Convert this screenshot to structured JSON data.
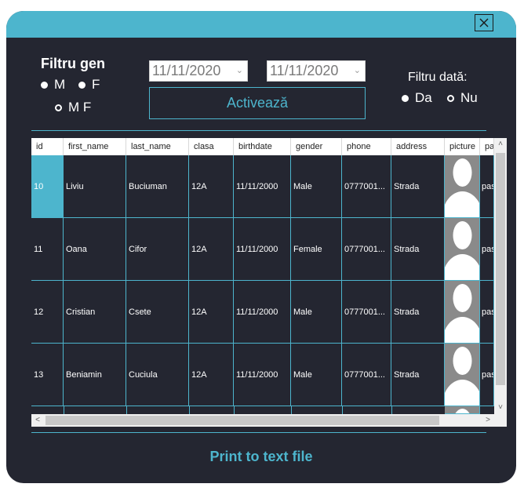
{
  "filters": {
    "gender_title": "Filtru gen",
    "gender_options": {
      "m": "M",
      "f": "F",
      "mf": "M F"
    },
    "date_from": "11/11/2020",
    "date_to": "11/11/2020",
    "activate_label": "Activează",
    "date_title": "Filtru dată:",
    "date_options": {
      "da": "Da",
      "nu": "Nu"
    }
  },
  "table": {
    "columns": [
      "id",
      "first_name",
      "last_name",
      "clasa",
      "birthdate",
      "gender",
      "phone",
      "address",
      "picture",
      "pa"
    ],
    "rows": [
      {
        "id": "10",
        "first_name": "Liviu",
        "last_name": "Buciuman",
        "clasa": "12A",
        "birthdate": "11/11/2000",
        "gender": "Male",
        "phone": "0777001...",
        "address": "Strada",
        "pa": "pas"
      },
      {
        "id": "11",
        "first_name": "Oana",
        "last_name": "Cifor",
        "clasa": "12A",
        "birthdate": "11/11/2000",
        "gender": "Female",
        "phone": "0777001...",
        "address": "Strada",
        "pa": "pas"
      },
      {
        "id": "12",
        "first_name": "Cristian",
        "last_name": "Csete",
        "clasa": "12A",
        "birthdate": "11/11/2000",
        "gender": "Male",
        "phone": "0777001...",
        "address": "Strada",
        "pa": "pas"
      },
      {
        "id": "13",
        "first_name": "Beniamin",
        "last_name": "Cuciula",
        "clasa": "12A",
        "birthdate": "11/11/2000",
        "gender": "Male",
        "phone": "0777001...",
        "address": "Strada",
        "pa": "pas"
      }
    ]
  },
  "print_label": "Print to text file",
  "colors": {
    "accent": "#4db5cd",
    "background": "#242631",
    "header": "#ffffff"
  }
}
